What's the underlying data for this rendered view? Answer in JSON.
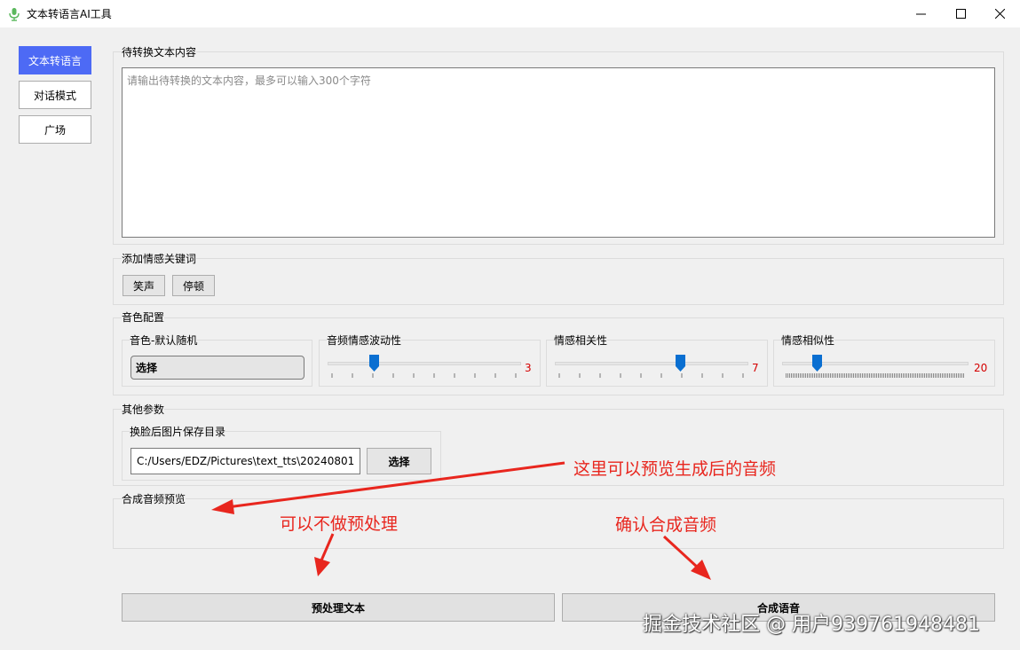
{
  "window": {
    "title": "文本转语言AI工具",
    "icon": "microphone-icon"
  },
  "nav": {
    "items": [
      {
        "label": "文本转语言",
        "active": true
      },
      {
        "label": "对话模式",
        "active": false
      },
      {
        "label": "广场",
        "active": false
      }
    ]
  },
  "text_section": {
    "label": "待转换文本内容",
    "placeholder": "请输出待转换的文本内容，最多可以输入300个字符",
    "value": ""
  },
  "emotion_section": {
    "label": "添加情感关键词",
    "buttons": [
      "笑声",
      "停顿"
    ]
  },
  "voice_section": {
    "label": "音色配置",
    "voice": {
      "label": "音色-默认随机",
      "button": "选择"
    },
    "sliders": [
      {
        "label": "音频情感波动性",
        "value": "3",
        "fraction": 0.24
      },
      {
        "label": "情感相关性",
        "value": "7",
        "fraction": 0.65
      },
      {
        "label": "情感相似性",
        "value": "20",
        "fraction": 0.19
      }
    ]
  },
  "other_section": {
    "label": "其他参数",
    "save_dir": {
      "label": "换脸后图片保存目录",
      "value": "C:/Users/EDZ/Pictures\\text_tts\\20240801",
      "button": "选择"
    }
  },
  "preview_section": {
    "label": "合成音频预览"
  },
  "actions": {
    "preprocess": "预处理文本",
    "synthesize": "合成语音"
  },
  "annotations": {
    "preview_note": "这里可以预览生成后的音频",
    "preprocess_note": "可以不做预处理",
    "synth_note": "确认合成音频",
    "color": "#e8261e"
  },
  "watermark": "掘金技术社区 @ 用户939761948481",
  "colors": {
    "accent": "#4d6af5",
    "slider_value": "#d40000",
    "slider_thumb": "#0a6fd1"
  }
}
